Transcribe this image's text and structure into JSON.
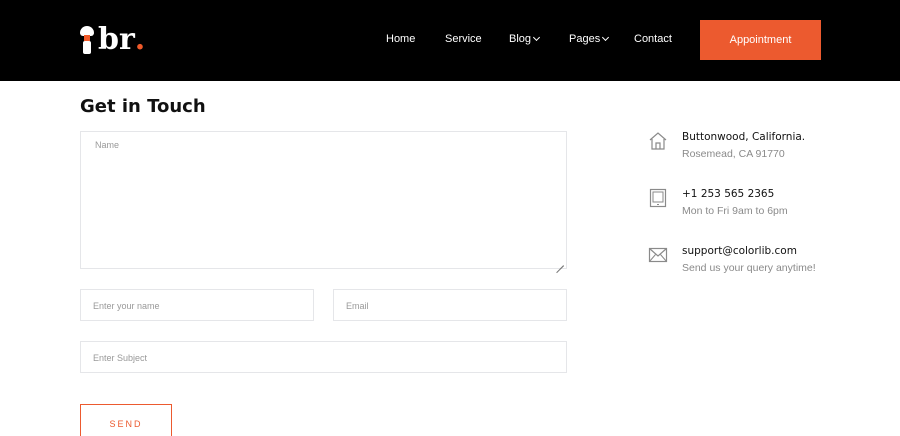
{
  "brand": {
    "logo_text": "br",
    "logo_dot": ".",
    "accent": "#ec5a2f"
  },
  "nav": {
    "items": [
      {
        "label": "Home",
        "has_dropdown": false
      },
      {
        "label": "Service",
        "has_dropdown": false
      },
      {
        "label": "Blog",
        "has_dropdown": true
      },
      {
        "label": "Pages",
        "has_dropdown": true
      },
      {
        "label": "Contact",
        "has_dropdown": false
      }
    ],
    "cta_label": "Appointment"
  },
  "section": {
    "title": "Get in Touch"
  },
  "form": {
    "message_placeholder": "Name",
    "name_placeholder": "Enter your name",
    "email_placeholder": "Email",
    "subject_placeholder": "Enter Subject",
    "submit_label": "SEND"
  },
  "contact_info": [
    {
      "icon": "home-icon",
      "title": "Buttonwood, California.",
      "subtitle": "Rosemead, CA 91770"
    },
    {
      "icon": "tablet-icon",
      "title": "+1 253 565 2365",
      "subtitle": "Mon to Fri 9am to 6pm"
    },
    {
      "icon": "email-icon",
      "title": "support@colorlib.com",
      "subtitle": "Send us your query anytime!"
    }
  ]
}
